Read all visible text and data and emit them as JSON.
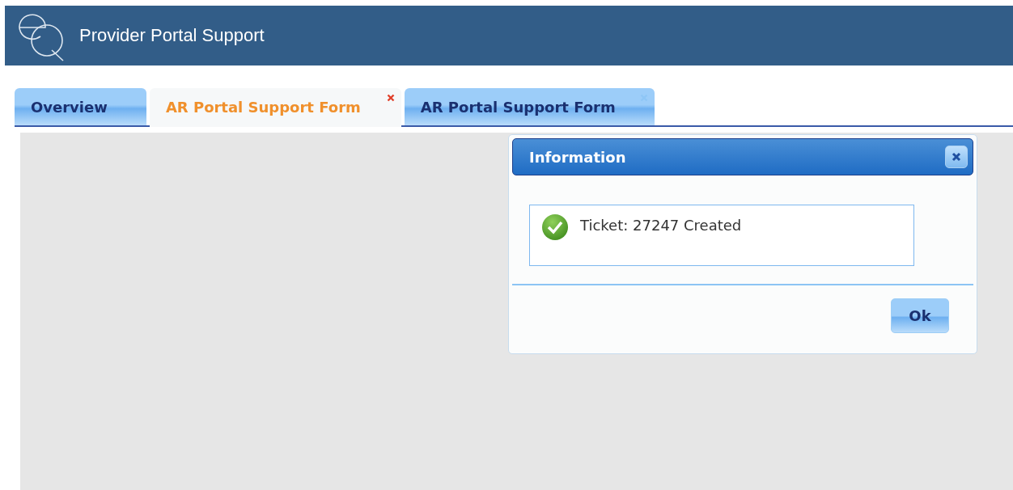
{
  "header": {
    "title": "Provider Portal Support"
  },
  "tabs": [
    {
      "label": "Overview",
      "selected": false,
      "closable": false
    },
    {
      "label": "AR Portal Support Form",
      "selected": true,
      "closable": true
    },
    {
      "label": "AR Portal Support Form",
      "selected": false,
      "closable": true
    }
  ],
  "dialog": {
    "title": "Information",
    "message": "Ticket: 27247 Created",
    "buttons": [
      "Ok"
    ]
  }
}
